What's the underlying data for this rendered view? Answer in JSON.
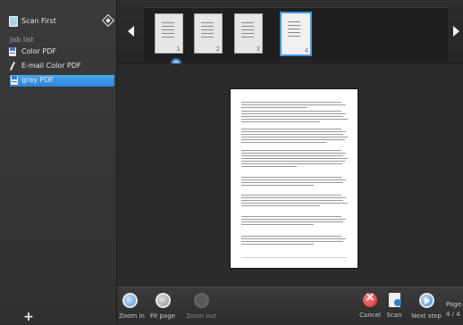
{
  "sidebar": {
    "scan_first_label": "Scan First",
    "job_list_header": "Job list",
    "jobs": [
      {
        "label": "Color PDF",
        "icon": "pdf-icon"
      },
      {
        "label": "E-mail Color PDF",
        "icon": "pen-icon"
      },
      {
        "label": "gray PDF",
        "icon": "pdf-icon",
        "selected": true
      }
    ],
    "add_label": "+"
  },
  "thumbnails": {
    "pages": [
      {
        "number": "1"
      },
      {
        "number": "2"
      },
      {
        "number": "3"
      },
      {
        "number": "4",
        "selected": true
      }
    ]
  },
  "toolbar": {
    "zoom_in": "Zoom in",
    "fit_page": "Fit page",
    "zoom_out": "Zoom out",
    "cancel": "Cancel",
    "scan": "Scan",
    "next_step": "Next step",
    "page_label": "Page:",
    "page_value": "4 / 4"
  },
  "colors": {
    "accent": "#3c97e5",
    "cancel": "#d22a2a"
  }
}
